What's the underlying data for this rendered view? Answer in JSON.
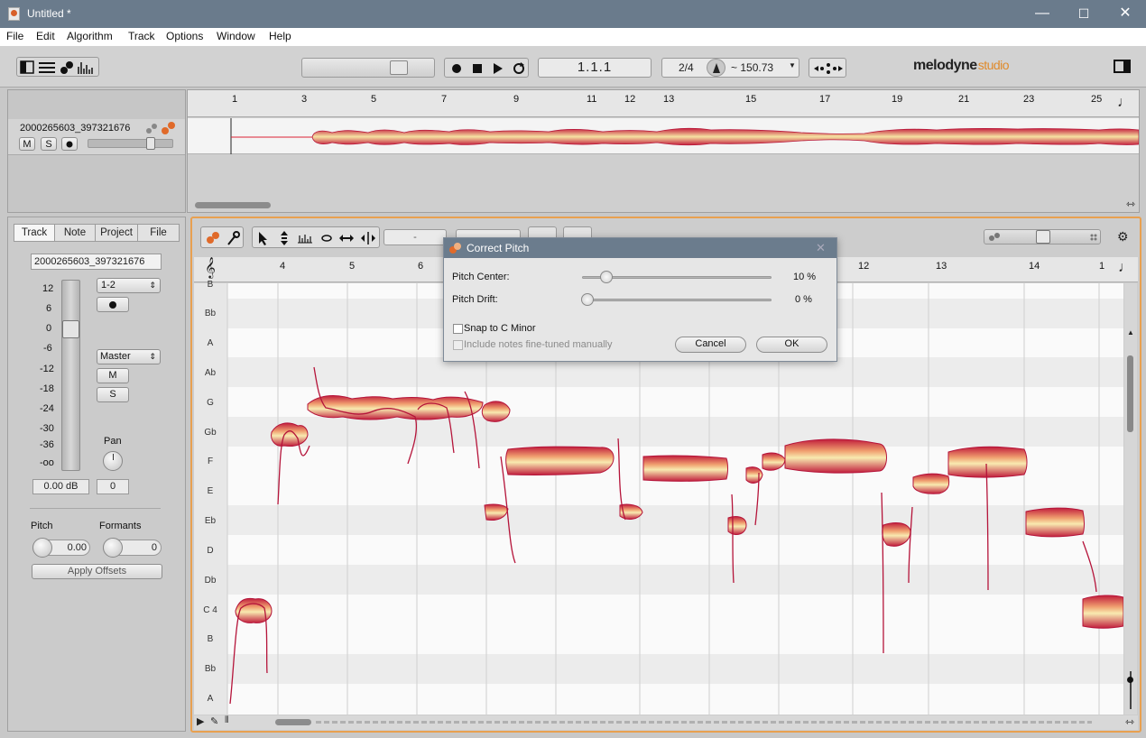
{
  "window": {
    "title": "Untitled *",
    "minimize": "—",
    "maximize": "☐",
    "close": "✕"
  },
  "menu": [
    "File",
    "Edit",
    "Algorithm",
    "Track",
    "Options",
    "Window",
    "Help"
  ],
  "transport": {
    "position": "1.1.1",
    "time_signature": "2/4",
    "tempo": "~ 150.73"
  },
  "brand": {
    "name": "melodyne",
    "edition": "studio"
  },
  "overview": {
    "track_name": "2000265603_397321676",
    "mute": "M",
    "solo": "S",
    "ruler": [
      "1",
      "3",
      "5",
      "7",
      "9",
      "11",
      "12",
      "13",
      "15",
      "17",
      "19",
      "21",
      "23",
      "25"
    ]
  },
  "inspector": {
    "tabs": [
      "Track",
      "Note",
      "Project",
      "File"
    ],
    "active_tab": "Track",
    "track_name": "2000265603_397321676",
    "db_scale": [
      "12",
      "6",
      "0",
      "-6",
      "-12",
      "-18",
      "-24",
      "-30",
      "-36",
      "-oo"
    ],
    "input": "1-2",
    "output": "Master",
    "mute": "M",
    "solo": "S",
    "pan_label": "Pan",
    "volume_db": "0.00 dB",
    "pan_value": "0",
    "pitch_label": "Pitch",
    "pitch_value": "0.00",
    "formants_label": "Formants",
    "formants_value": "0",
    "apply_offsets": "Apply Offsets"
  },
  "editor": {
    "ruler": [
      "4",
      "5",
      "6",
      "12",
      "13",
      "14",
      "1"
    ],
    "pitch_labels": [
      "B",
      "Bb",
      "A",
      "Ab",
      "G",
      "Gb",
      "F",
      "E",
      "Eb",
      "D",
      "Db",
      "C 4",
      "B",
      "Bb",
      "A"
    ],
    "toolbar_field1": "-"
  },
  "dialog": {
    "title": "Correct Pitch",
    "pitch_center_label": "Pitch Center:",
    "pitch_center_value": "10 %",
    "pitch_center_fraction": 0.1,
    "pitch_drift_label": "Pitch Drift:",
    "pitch_drift_value": "0 %",
    "pitch_drift_fraction": 0.0,
    "snap_label": "Snap to C Minor",
    "include_label": "Include notes fine-tuned manually",
    "cancel": "Cancel",
    "ok": "OK"
  },
  "colors": {
    "titlebar": "#6a7b8c",
    "blob_edge": "#c0203a",
    "blob_core": "#f5e3a0",
    "accent_orange": "#e08a2a"
  }
}
